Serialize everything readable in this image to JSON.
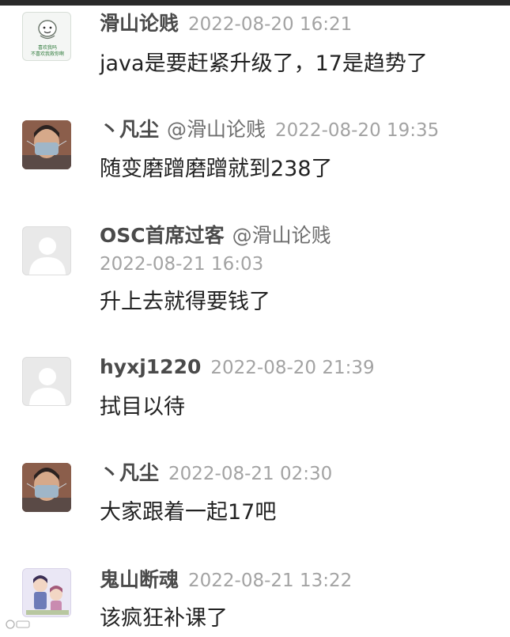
{
  "comments": [
    {
      "name": "滑山论贱",
      "time": "2022-08-20 16:21",
      "content": "java是要赶紧升级了，17是趋势了",
      "avatar": "meme-avatar",
      "avatar_lines": [
        "喜欢我吗",
        "不喜欢我救你啊"
      ]
    },
    {
      "name": "丶凡尘",
      "mention": "@滑山论贱",
      "time": "2022-08-20 19:35",
      "content": "随变磨蹭磨蹭就到238了",
      "avatar": "photo-avatar"
    },
    {
      "name": "OSC首席过客",
      "mention": "@滑山论贱",
      "time": "2022-08-21 16:03",
      "content": "升上去就得要钱了",
      "avatar": "default-avatar"
    },
    {
      "name": "hyxj1220",
      "time": "2022-08-20 21:39",
      "content": "拭目以待",
      "avatar": "default-avatar"
    },
    {
      "name": "丶凡尘",
      "time": "2022-08-21 02:30",
      "content": "大家跟着一起17吧",
      "avatar": "photo-avatar"
    },
    {
      "name": "鬼山断魂",
      "time": "2022-08-21 13:22",
      "content": "该疯狂补课了",
      "avatar": "anime-avatar"
    }
  ],
  "colors": {
    "name": "#4a4a4a",
    "mention": "#6f6f6f",
    "time": "#a3a3a3",
    "content": "#222222"
  }
}
